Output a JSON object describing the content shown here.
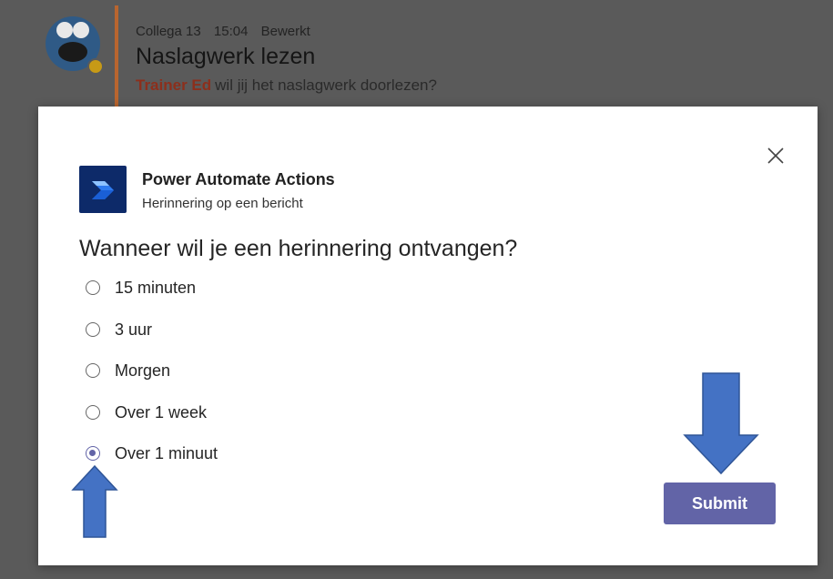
{
  "message": {
    "author": "Collega 13",
    "time": "15:04",
    "edited": "Bewerkt",
    "title": "Naslagwerk lezen",
    "mention": "Trainer Ed",
    "body": "wil jij het naslagwerk doorlezen?"
  },
  "dialog": {
    "app_name": "Power Automate Actions",
    "app_subtitle": "Herinnering op een bericht",
    "question": "Wanneer wil je een herinnering ontvangen?",
    "options": [
      {
        "label": "15 minuten",
        "selected": false
      },
      {
        "label": "3 uur",
        "selected": false
      },
      {
        "label": "Morgen",
        "selected": false
      },
      {
        "label": "Over 1 week",
        "selected": false
      },
      {
        "label": "Over 1 minuut",
        "selected": true
      }
    ],
    "submit_label": "Submit"
  },
  "colors": {
    "accent": "#6264a7",
    "annotation_arrow": "#4472c4",
    "message_bar": "#b9652f"
  },
  "icons": {
    "close": "close-icon",
    "app": "power-automate-icon",
    "avatar": "avatar"
  }
}
